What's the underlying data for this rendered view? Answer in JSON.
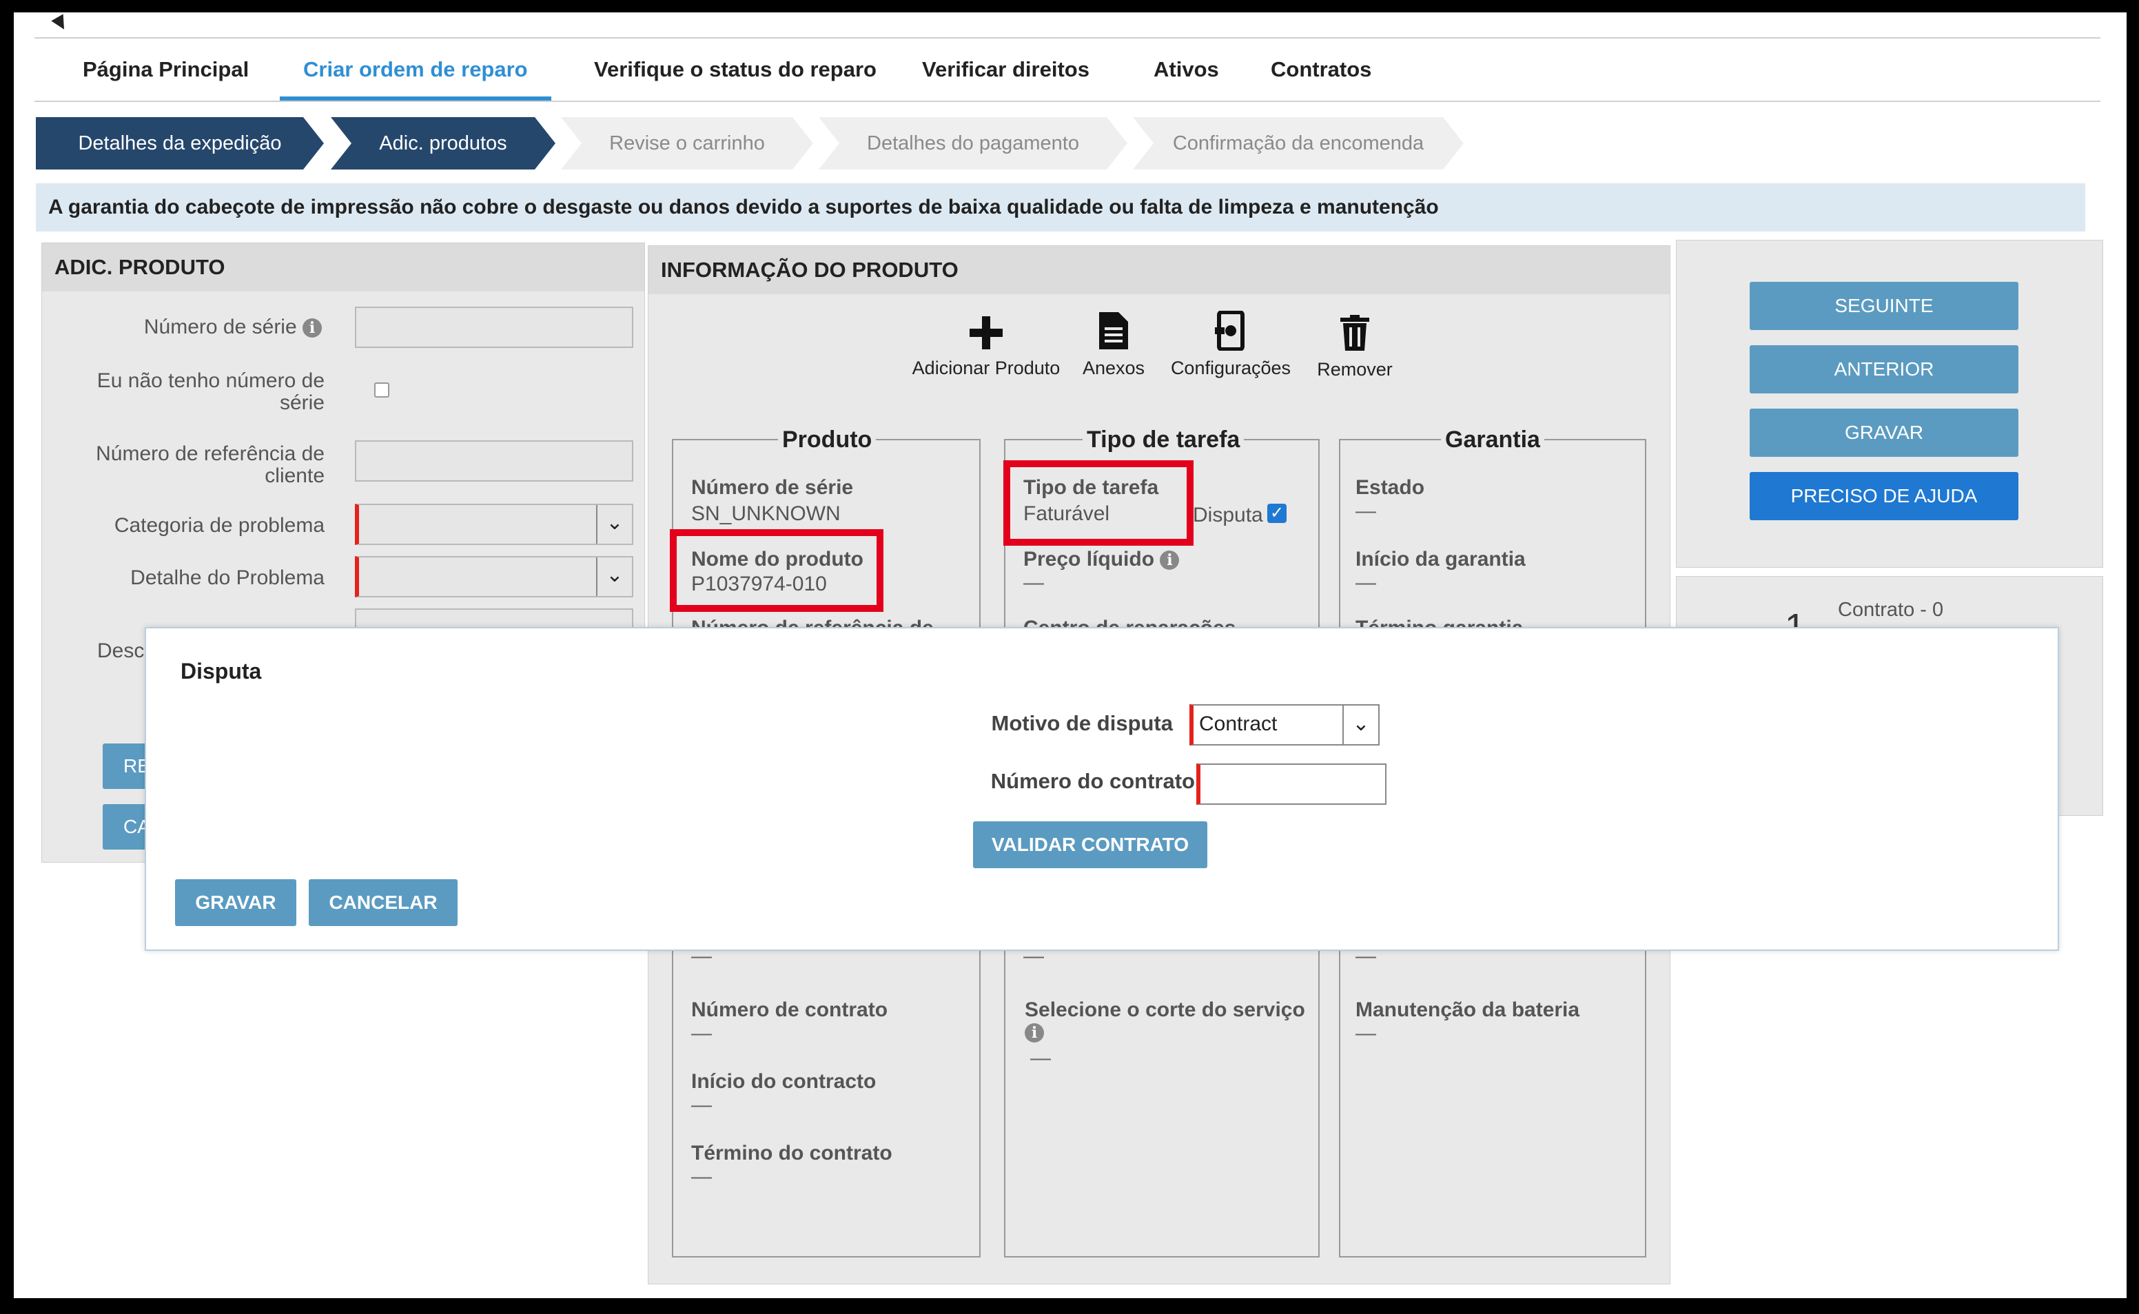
{
  "nav": {
    "tabs": [
      {
        "label": "Página Principal"
      },
      {
        "label": "Criar ordem de reparo"
      },
      {
        "label": "Verifique o status do reparo"
      },
      {
        "label": "Verificar direitos"
      },
      {
        "label": "Ativos"
      },
      {
        "label": "Contratos"
      }
    ],
    "active_index": 1
  },
  "steps": [
    {
      "label": "Detalhes da expedição",
      "done": true
    },
    {
      "label": "Adic. produtos",
      "done": true
    },
    {
      "label": "Revise o carrinho",
      "done": false
    },
    {
      "label": "Detalhes do pagamento",
      "done": false
    },
    {
      "label": "Confirmação da encomenda",
      "done": false
    }
  ],
  "banner": "A garantia do cabeçote de impressão não cobre o desgaste ou danos devido a suportes de baixa qualidade ou falta de limpeza e manutenção",
  "add_product": {
    "title": "ADIC. PRODUTO",
    "serial_label": "Número de série",
    "no_serial_label_1": "Eu não tenho número de",
    "no_serial_label_2": "série",
    "ref_label_1": "Número de referência de",
    "ref_label_2": "cliente",
    "problem_cat_label": "Categoria de problema",
    "problem_detail_label": "Detalhe do Problema",
    "desc_label_partial": "Desc",
    "btn1_partial": "RED",
    "btn2_partial": "CAR"
  },
  "product_info": {
    "title": "INFORMAÇÃO DO PRODUTO",
    "toolbar": {
      "add": "Adicionar Produto",
      "attachments": "Anexos",
      "settings": "Configurações",
      "remove": "Remover"
    },
    "produto": {
      "legend": "Produto",
      "serial_label": "Número de série",
      "serial_value": "SN_UNKNOWN",
      "name_label": "Nome do produto",
      "name_value": "P1037974-010",
      "ref_partial": "Número de referência de",
      "contract_num_label": "Número de contrato",
      "contract_start_label": "Início do contracto",
      "contract_end_label": "Término do contrato",
      "dash": "—"
    },
    "tarefa": {
      "legend": "Tipo de tarefa",
      "type_label": "Tipo de tarefa",
      "type_value": "Faturável",
      "dispute_label": "Disputa",
      "net_price_label": "Preço líquido",
      "repair_center_partial": "Centro de reparações",
      "service_cut_label": "Selecione o corte do serviço",
      "dash": "—"
    },
    "garantia": {
      "legend": "Garantia",
      "state_label": "Estado",
      "start_label": "Início da garantia",
      "end_partial": "Término garantia",
      "battery_label": "Manutenção da bateria",
      "dash": "—"
    }
  },
  "actions": {
    "next": "SEGUINTE",
    "previous": "ANTERIOR",
    "save": "GRAVAR",
    "help": "PRECISO DE AJUDA"
  },
  "contract_panel": {
    "big_partial": "— 1",
    "label": "Contrato - 0"
  },
  "modal": {
    "title": "Disputa",
    "reason_label": "Motivo de disputa",
    "reason_value": "Contract",
    "contract_label": "Número do contrato",
    "validate": "VALIDAR CONTRATO",
    "save": "GRAVAR",
    "cancel": "CANCELAR"
  },
  "colors": {
    "nav_active": "#2f8fd3",
    "step_done": "#26476c",
    "button": "#5b9bc1",
    "primary": "#1f78d1",
    "highlight": "#e3001b"
  }
}
